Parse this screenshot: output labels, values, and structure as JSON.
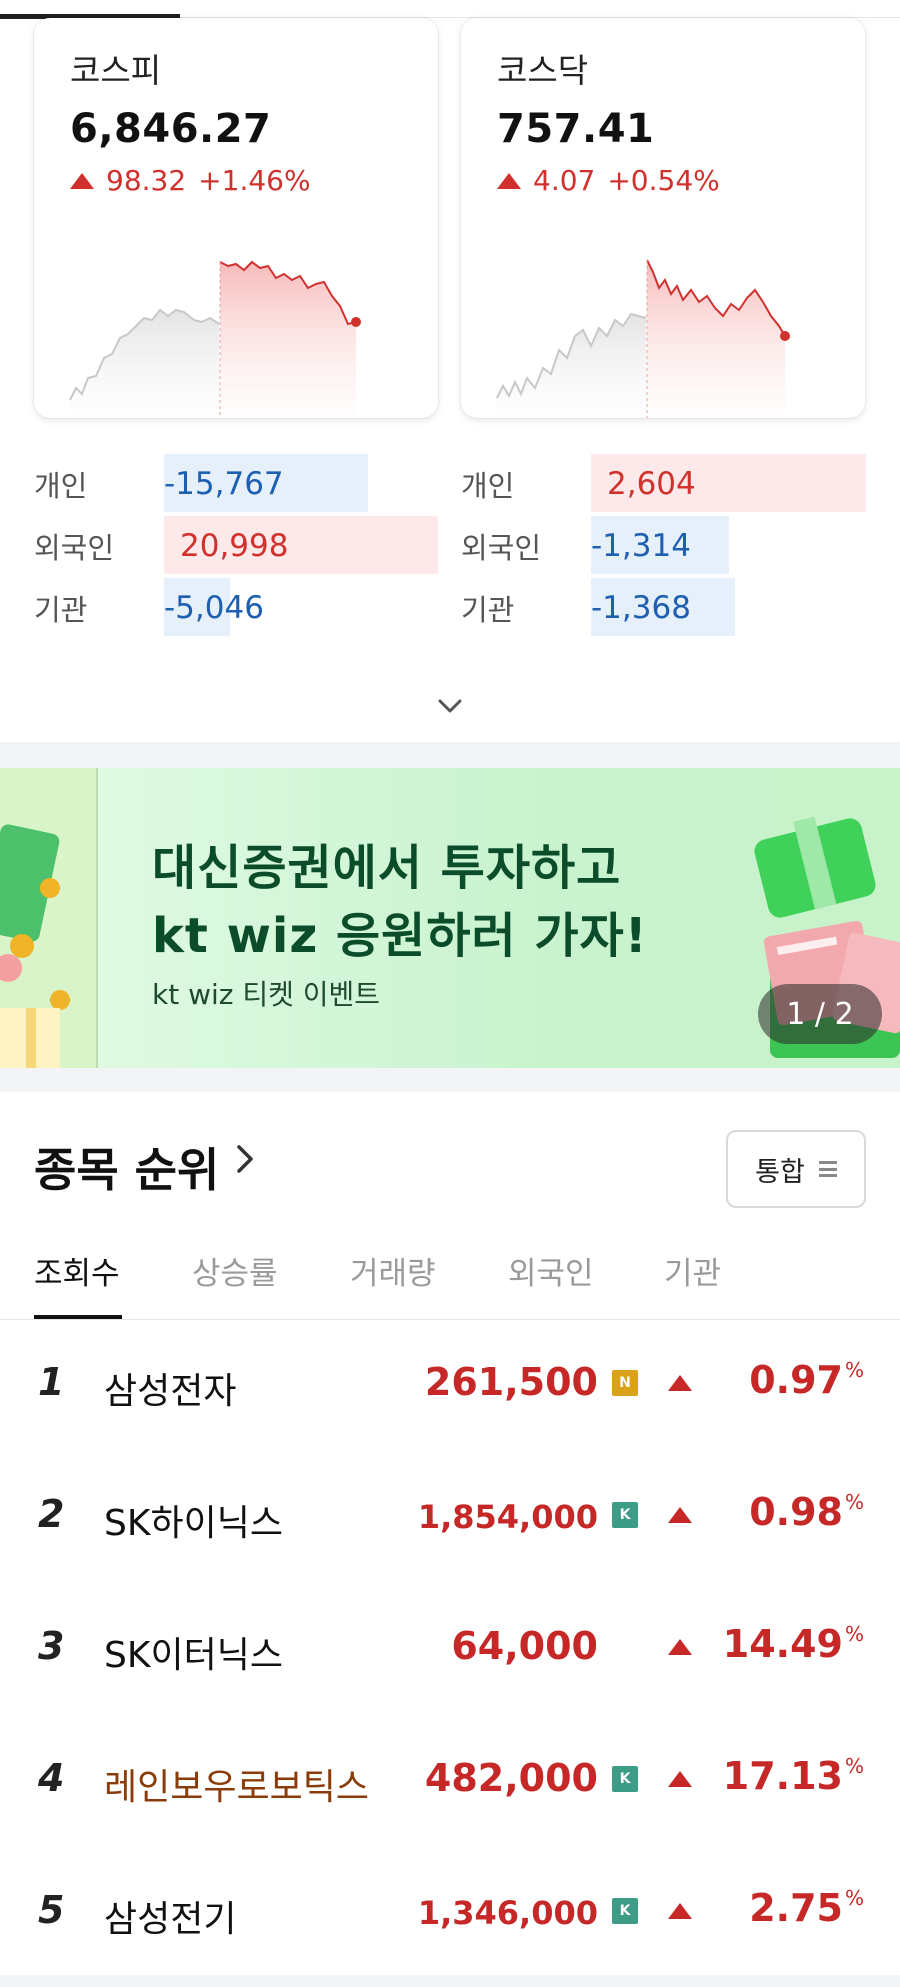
{
  "indices": [
    {
      "name": "코스피",
      "value": "6,846.27",
      "change": "98.32",
      "pct": "+1.46%"
    },
    {
      "name": "코스닥",
      "value": "757.41",
      "change": "4.07",
      "pct": "+0.54%"
    }
  ],
  "investors": {
    "kospi": [
      {
        "label": "개인",
        "value": "-15,767",
        "sign": "neg"
      },
      {
        "label": "외국인",
        "value": "20,998",
        "sign": "pos"
      },
      {
        "label": "기관",
        "value": "-5,046",
        "sign": "neg"
      }
    ],
    "kosdaq": [
      {
        "label": "개인",
        "value": "2,604",
        "sign": "pos"
      },
      {
        "label": "외국인",
        "value": "-1,314",
        "sign": "neg"
      },
      {
        "label": "기관",
        "value": "-1,368",
        "sign": "neg"
      }
    ]
  },
  "banner": {
    "line1": "대신증권에서 투자하고",
    "line2": "kt wiz 응원하러 가자!",
    "sub": "kt wiz 티켓 이벤트",
    "pager": "1 / 2"
  },
  "ranking": {
    "title": "종목 순위",
    "filter_label": "통합",
    "tabs": [
      "조회수",
      "상승률",
      "거래량",
      "외국인",
      "기관"
    ],
    "active_tab": 0,
    "rows": [
      {
        "rank": "1",
        "name": "삼성전자",
        "price": "261,500",
        "badge": "N",
        "pct": "0.97",
        "unit": "%"
      },
      {
        "rank": "2",
        "name": "SK하이닉스",
        "price": "1,854,000",
        "badge": "K",
        "pct": "0.98",
        "unit": "%"
      },
      {
        "rank": "3",
        "name": "SK이터닉스",
        "price": "64,000",
        "badge": "",
        "pct": "14.49",
        "unit": "%"
      },
      {
        "rank": "4",
        "name": "레인보우로보틱스",
        "price": "482,000",
        "badge": "K",
        "pct": "17.13",
        "unit": "%"
      },
      {
        "rank": "5",
        "name": "삼성전기",
        "price": "1,346,000",
        "badge": "K",
        "pct": "2.75",
        "unit": "%"
      }
    ]
  },
  "colors": {
    "up": "#d0312d",
    "down": "#1e5fb0",
    "banner_text": "#0b4d2a"
  }
}
